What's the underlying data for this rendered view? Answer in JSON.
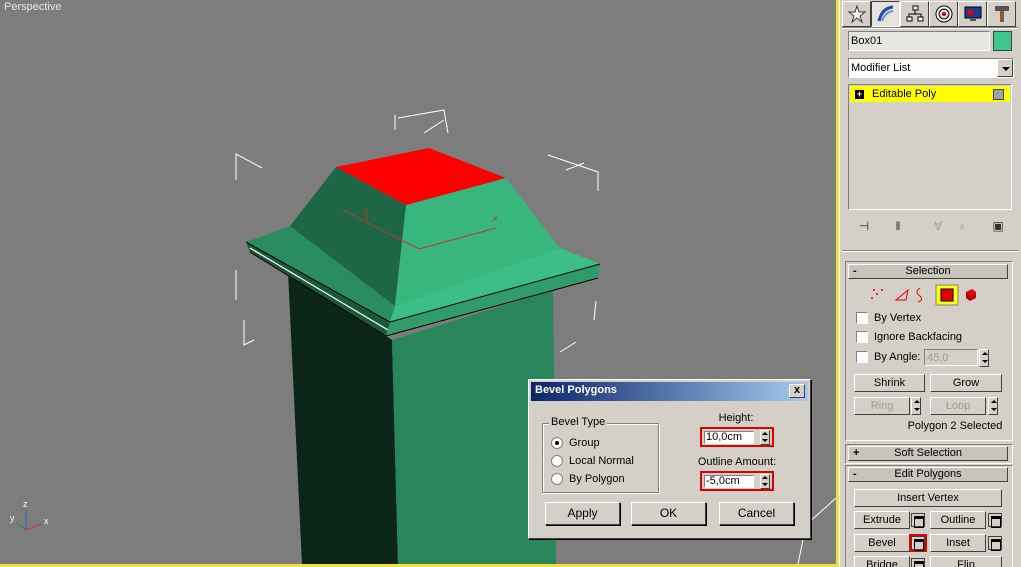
{
  "viewport": {
    "label": "Perspective",
    "axes": {
      "x": "x",
      "y": "y",
      "z": "z"
    }
  },
  "command_panel": {
    "tabs": [
      "create-icon",
      "modify-icon",
      "hierarchy-icon",
      "motion-icon",
      "display-icon",
      "utilities-icon"
    ],
    "object_name": "Box01",
    "object_color": "#3cc88c",
    "modifier_list": "Modifier List",
    "stack": {
      "item": "Editable Poly"
    },
    "selection": {
      "title": "Selection",
      "collapse": "-",
      "by_vertex": "By Vertex",
      "ignore_backfacing": "Ignore Backfacing",
      "by_angle": "By Angle:",
      "angle_value": "45,0",
      "shrink": "Shrink",
      "grow": "Grow",
      "ring": "Ring",
      "loop": "Loop",
      "status": "Polygon 2 Selected"
    },
    "soft_selection": {
      "title": "Soft Selection",
      "expand": "+"
    },
    "edit_polygons": {
      "title": "Edit Polygons",
      "collapse": "-",
      "insert_vertex": "Insert Vertex",
      "extrude": "Extrude",
      "outline": "Outline",
      "bevel": "Bevel",
      "inset": "Inset",
      "bridge": "Bridge",
      "flip": "Flip"
    }
  },
  "dialog": {
    "title": "Bevel Polygons",
    "close": "x",
    "bevel_type": {
      "label": "Bevel Type",
      "options": [
        "Group",
        "Local Normal",
        "By Polygon"
      ],
      "selected": "Group"
    },
    "height_label": "Height:",
    "height_value": "10,0cm",
    "outline_label": "Outline Amount:",
    "outline_value": "-5,0cm",
    "apply": "Apply",
    "ok": "OK",
    "cancel": "Cancel"
  }
}
